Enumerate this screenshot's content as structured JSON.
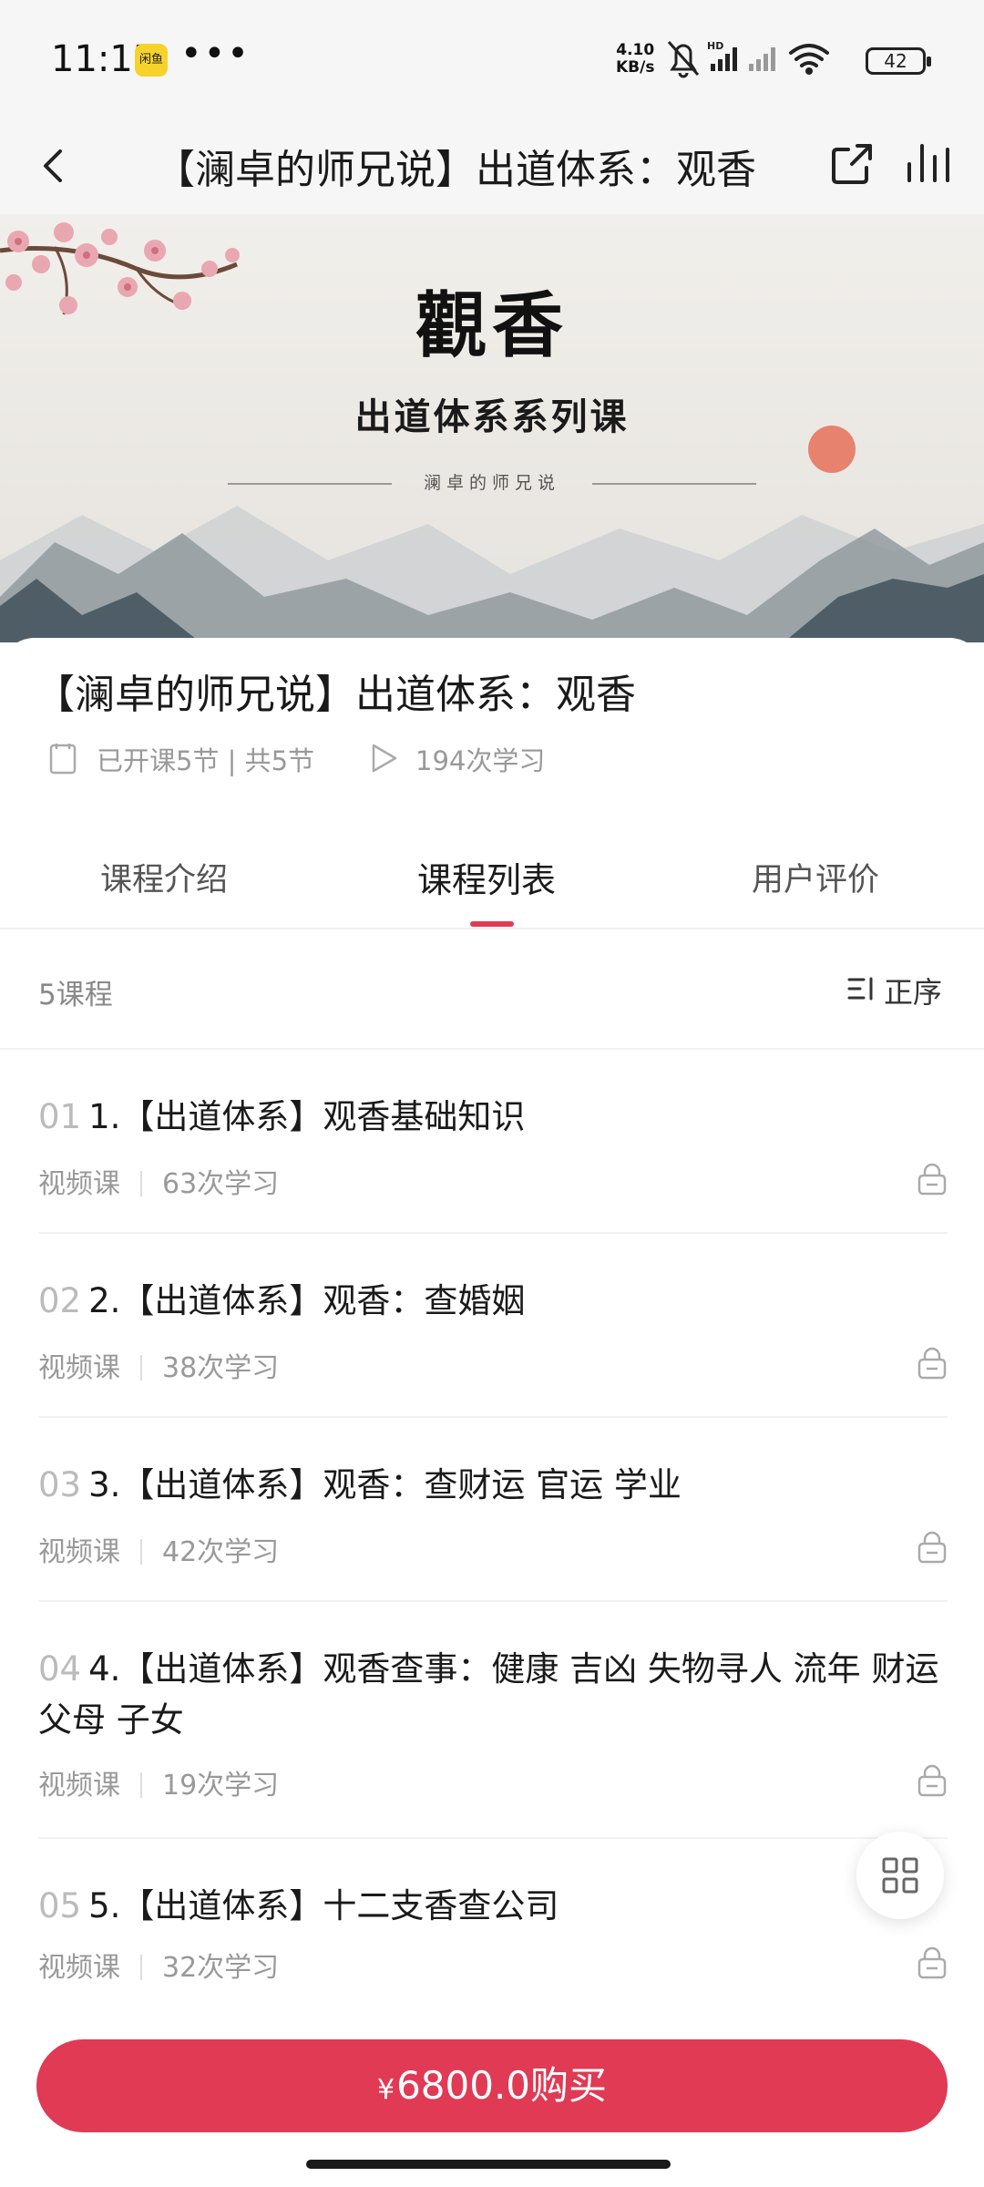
{
  "status_bar": {
    "time": "11:13",
    "app_icon_label": "闲鱼",
    "dots": "•••",
    "net_speed_value": "4.10",
    "net_speed_unit": "KB/s",
    "battery": "42"
  },
  "header": {
    "title": "【澜卓的师兄说】出道体系：观香"
  },
  "banner": {
    "title": "觀香",
    "subtitle": "出道体系系列课",
    "author": "澜卓的师兄说"
  },
  "course": {
    "title": "【澜卓的师兄说】出道体系：观香",
    "lessons_text": "已开课5节 | 共5节",
    "views_text": "194次学习"
  },
  "tabs": [
    {
      "label": "课程介绍"
    },
    {
      "label": "课程列表"
    },
    {
      "label": "用户评价"
    }
  ],
  "list": {
    "count_label": "5课程",
    "sort_label": "正序",
    "items": [
      {
        "num": "01",
        "title": "1.【出道体系】观香基础知识",
        "type": "视频课",
        "views": "63次学习"
      },
      {
        "num": "02",
        "title": "2.【出道体系】观香：查婚姻",
        "type": "视频课",
        "views": "38次学习"
      },
      {
        "num": "03",
        "title": "3.【出道体系】观香：查财运 官运 学业",
        "type": "视频课",
        "views": "42次学习"
      },
      {
        "num": "04",
        "title": "4.【出道体系】观香查事：健康 吉凶 失物寻人 流年 财运 父母 子女",
        "type": "视频课",
        "views": "19次学习"
      },
      {
        "num": "05",
        "title": "5.【出道体系】十二支香查公司",
        "type": "视频课",
        "views": "32次学习"
      }
    ]
  },
  "buy": {
    "currency": "¥",
    "label": "6800.0购买"
  },
  "colors": {
    "accent": "#e03a55",
    "status_bar_bg": "#f6f6f6",
    "muted_text": "#999999"
  }
}
